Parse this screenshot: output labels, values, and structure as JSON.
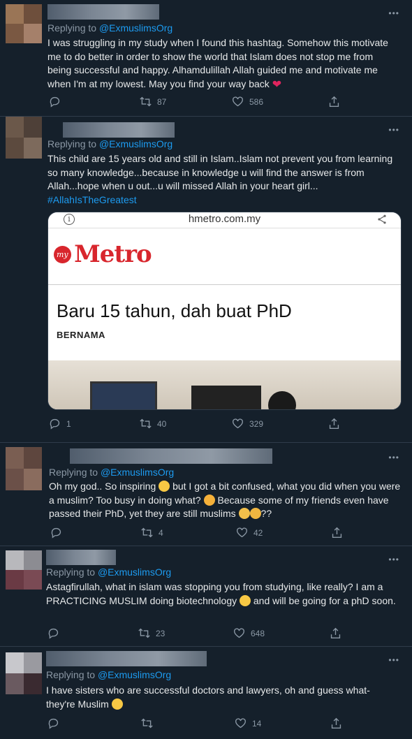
{
  "tweets": [
    {
      "reply_prefix": "Replying to",
      "reply_handle": "@ExmuslimsOrg",
      "text": "I was struggling in my study when I found this hashtag. Somehow this motivate me to do better in order to show the world that Islam does not stop me from being successful and happy. Alhamdulillah Allah guided me and motivate me when I'm at my lowest. May you find your way back",
      "reply_count": "",
      "retweet_count": "87",
      "like_count": "586"
    },
    {
      "reply_prefix": "Replying to",
      "reply_handle": "@ExmuslimsOrg",
      "text": "This child are 15 years old and still in Islam..Islam not prevent you from learning so many knowledge...because in knowledge u will find the answer is from Allah...hope when u out...u will missed Allah in your heart girl...",
      "hashtag": "#AllahIsTheGreatest",
      "reply_count": "1",
      "retweet_count": "40",
      "like_count": "329",
      "card": {
        "url": "hmetro.com.my",
        "logo_prefix": "my",
        "logo": "Metro",
        "headline": "Baru 15 tahun, dah buat PhD",
        "source": "BERNAMA"
      }
    },
    {
      "reply_prefix": "Replying to",
      "reply_handle": "@ExmuslimsOrg",
      "text_a": "Oh my god.. So inspiring",
      "text_b": "but I got a bit confused, what you did when you were a muslim? Too busy in doing what?",
      "text_c": "Because some of my friends even have passed their PhD, yet they are still muslims",
      "text_d": "??",
      "reply_count": "",
      "retweet_count": "4",
      "like_count": "42"
    },
    {
      "reply_prefix": "Replying to",
      "reply_handle": "@ExmuslimsOrg",
      "text_a": "Astagfirullah, what in islam was stopping you from studying, like really? I am a PRACTICING MUSLIM doing biotechnology",
      "text_b": "and will be going for a phD soon.",
      "reply_count": "",
      "retweet_count": "23",
      "like_count": "648"
    },
    {
      "reply_prefix": "Replying to",
      "reply_handle": "@ExmuslimsOrg",
      "text": "I have sisters who are successful doctors and lawyers, oh and guess what- they're Muslim",
      "reply_count": "",
      "retweet_count": "",
      "like_count": "14"
    }
  ],
  "more_label": "•••",
  "colors": {
    "background": "#15202b",
    "link": "#1d9bf0",
    "muted": "#8b98a5"
  }
}
